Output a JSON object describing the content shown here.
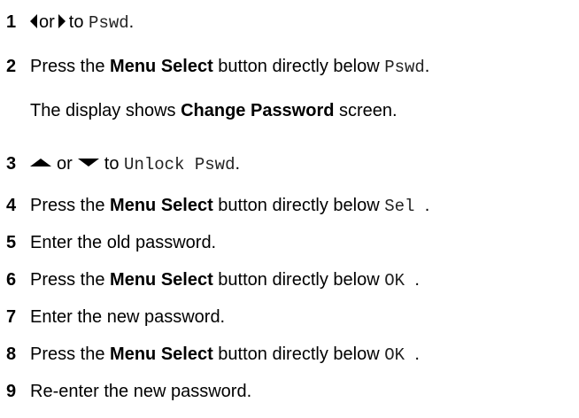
{
  "steps": [
    {
      "num": "1",
      "or_text": "or",
      "to_text": "to",
      "target": "Pswd",
      "end": "."
    },
    {
      "num": "2",
      "pre": "Press the ",
      "bold": "Menu Select",
      "mid": " button directly below ",
      "target": "Pswd",
      "end": ".",
      "note_pre": "The display shows ",
      "note_bold": "Change Password",
      "note_end": " screen."
    },
    {
      "num": "3",
      "or_text": "or",
      "to_text": "to",
      "target": "Unlock Pswd",
      "end": "."
    },
    {
      "num": "4",
      "pre": "Press the ",
      "bold": "Menu Select",
      "mid": " button directly below ",
      "target": "Sel ",
      "end": "."
    },
    {
      "num": "5",
      "text": "Enter the old password."
    },
    {
      "num": "6",
      "pre": "Press the ",
      "bold": "Menu Select",
      "mid": " button directly below ",
      "target": "OK ",
      "end": "."
    },
    {
      "num": "7",
      "text": "Enter the new password."
    },
    {
      "num": "8",
      "pre": "Press the ",
      "bold": "Menu Select",
      "mid": " button directly below ",
      "target": "OK ",
      "end": "."
    },
    {
      "num": "9",
      "text": "Re-enter the new password."
    }
  ],
  "icons": {
    "left": "left-arrow-icon",
    "right": "right-arrow-icon",
    "up": "up-arrow-icon",
    "down": "down-arrow-icon"
  }
}
